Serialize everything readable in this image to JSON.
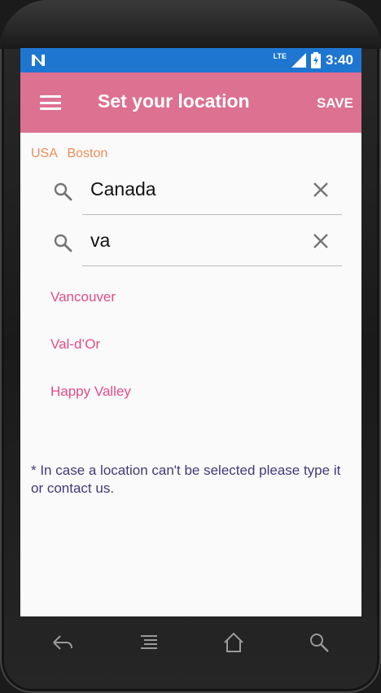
{
  "status_bar": {
    "network_label": "LTE",
    "time": "3:40",
    "color": "#1e76d0"
  },
  "app_bar": {
    "title": "Set your location",
    "save_label": "SAVE",
    "color": "#dc7192"
  },
  "current_location": {
    "country": "USA",
    "city": "Boston"
  },
  "country_field": {
    "value": "Canada"
  },
  "city_field": {
    "value": "va"
  },
  "suggestions": [
    "Vancouver",
    "Val-d’Or",
    "Happy Valley"
  ],
  "note": "* In case a location can't be selected please type it or contact us.",
  "nav_icons": [
    "back-icon",
    "menu-lines-icon",
    "home-icon",
    "search-icon"
  ]
}
